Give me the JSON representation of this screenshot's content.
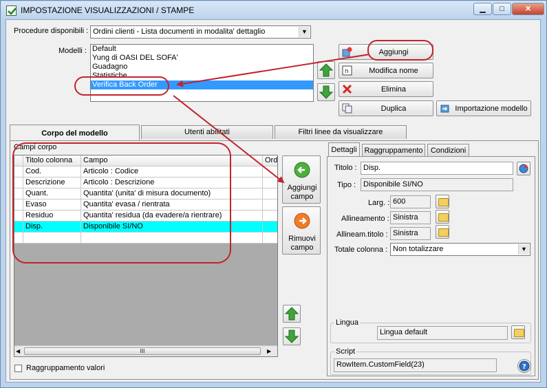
{
  "window": {
    "title": "IMPOSTAZIONE VISUALIZZAZIONI / STAMPE",
    "minimize": "▁",
    "maximize": "□",
    "close": "✕"
  },
  "top": {
    "procedure_label": "Procedure disponibili :",
    "procedure_value": "Ordini clienti - Lista documenti in modalita' dettaglio",
    "modelli_label": "Modelli :",
    "modelli": [
      "Default",
      "Yung di OASI DEL SOFA'",
      "Guadagno",
      "Statistiche",
      "Verifica Back Order"
    ],
    "selected_model_index": 4,
    "buttons": {
      "aggiungi": "Aggiungi",
      "modifica_nome": "Modifica nome",
      "elimina": "Elimina",
      "duplica": "Duplica",
      "importazione": "Importazione modello"
    }
  },
  "tabs": {
    "corpo": "Corpo del modello",
    "utenti": "Utenti abilitati",
    "filtri": "Filtri linee da visualizzare"
  },
  "corpo": {
    "campi_label": "Campi corpo",
    "columns": [
      "Titolo colonna",
      "Campo",
      "Ordi"
    ],
    "rows": [
      {
        "titolo": "Cod.",
        "campo": "Articolo : Codice"
      },
      {
        "titolo": "Descrizione",
        "campo": "Articolo : Descrizione"
      },
      {
        "titolo": "Quant.",
        "campo": "Quantita' (unita' di misura documento)"
      },
      {
        "titolo": "Evaso",
        "campo": "Quantita' evasa / rientrata"
      },
      {
        "titolo": "Residuo",
        "campo": "Quantita' residua (da evadere/a rientrare)"
      },
      {
        "titolo": "Disp.",
        "campo": "Disponibile SI/NO"
      }
    ],
    "highlighted_row_index": 5,
    "hscroll_grip": "III",
    "aggiungi_campo": "Aggiungi campo",
    "rimuovi_campo": "Rimuovi campo",
    "raggruppamento_valori": "Raggruppamento valori"
  },
  "dettagli": {
    "tabs": [
      "Dettagli",
      "Raggruppamento",
      "Condizioni"
    ],
    "titolo_label": "Titolo :",
    "titolo_value": "Disp.",
    "tipo_label": "Tipo :",
    "tipo_value": "Disponibile SI/NO",
    "larg_label": "Larg. :",
    "larg_value": "600",
    "allineamento_label": "Allineamento :",
    "allineamento_value": "Sinistra",
    "allineam_titolo_label": "Allineam.titolo :",
    "allineam_titolo_value": "Sinistra",
    "totale_label": "Totale colonna :",
    "totale_value": "Non totalizzare",
    "lingua_group": "Lingua",
    "lingua_value": "Lingua default",
    "script_group": "Script",
    "script_value": "RowItem.CustomField(23)"
  },
  "colors": {
    "titlebar": "#bcd3ec",
    "selection": "#3399ff",
    "highlight_row": "#00ffff",
    "annotation": "#c0242c",
    "arrow_green": "#3fa53a"
  }
}
